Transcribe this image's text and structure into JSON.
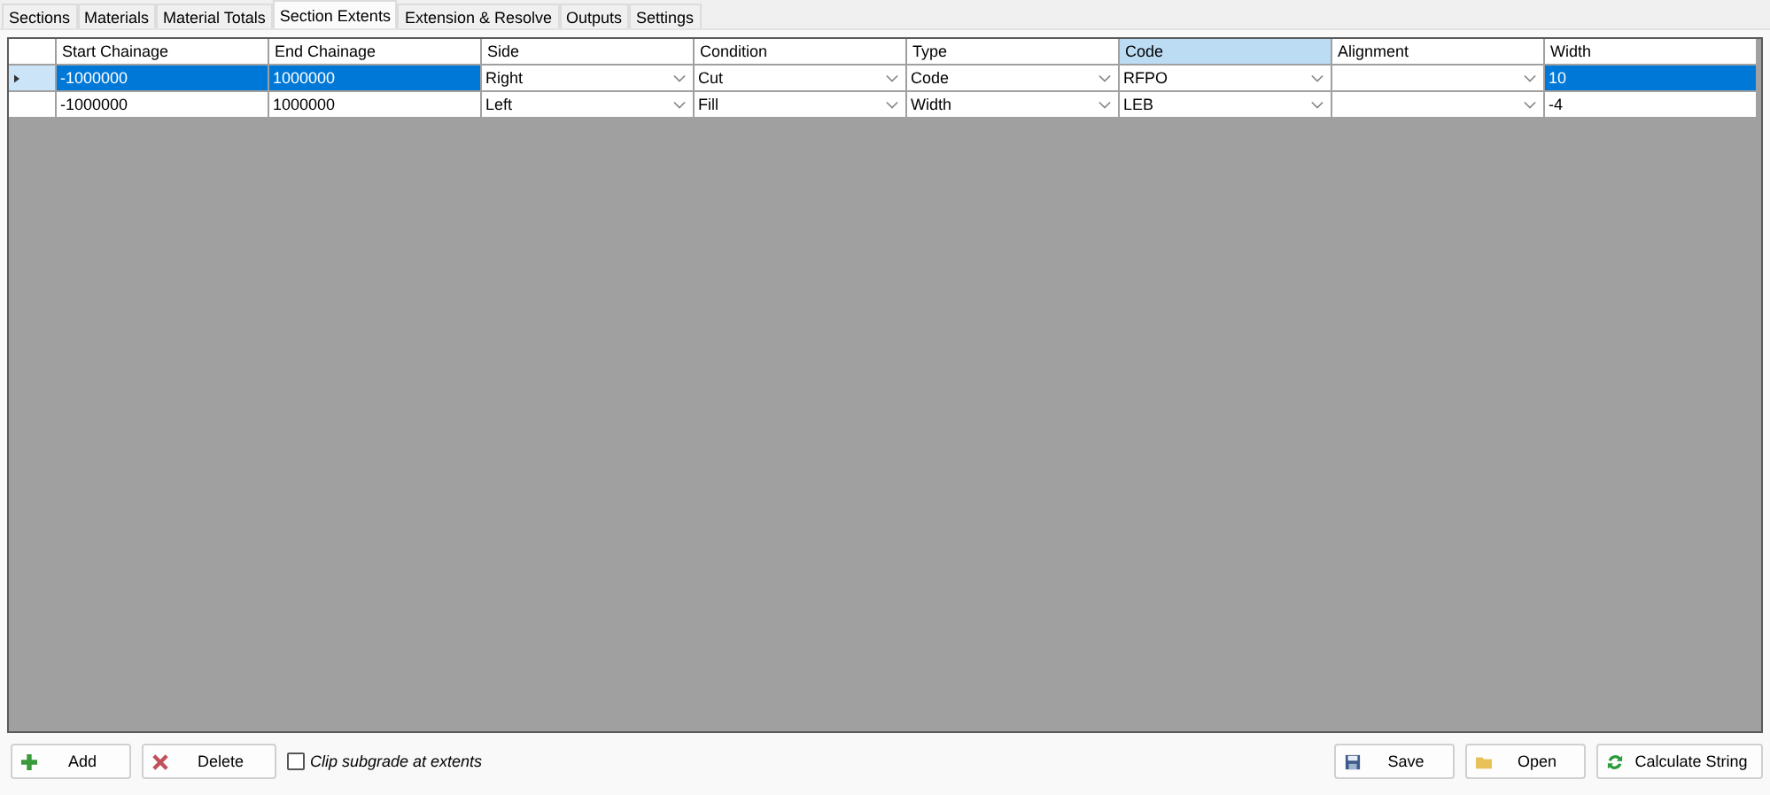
{
  "tabs": [
    {
      "label": "Sections",
      "selected": false
    },
    {
      "label": "Materials",
      "selected": false
    },
    {
      "label": "Material Totals",
      "selected": false
    },
    {
      "label": "Section Extents",
      "selected": true
    },
    {
      "label": "Extension & Resolve",
      "selected": false
    },
    {
      "label": "Outputs",
      "selected": false
    },
    {
      "label": "Settings",
      "selected": false
    }
  ],
  "grid": {
    "columns": [
      {
        "label": "Start Chainage",
        "kind": "text",
        "selected": false
      },
      {
        "label": "End Chainage",
        "kind": "text",
        "selected": false
      },
      {
        "label": "Side",
        "kind": "combo",
        "selected": false
      },
      {
        "label": "Condition",
        "kind": "combo",
        "selected": false
      },
      {
        "label": "Type",
        "kind": "combo",
        "selected": false
      },
      {
        "label": "Code",
        "kind": "combo",
        "selected": true
      },
      {
        "label": "Alignment",
        "kind": "combo",
        "selected": false
      },
      {
        "label": "Width",
        "kind": "text",
        "selected": false
      }
    ],
    "rows": [
      {
        "selected": true,
        "cells": [
          "-1000000",
          "1000000",
          "Right",
          "Cut",
          "Code",
          "RFPO",
          null,
          "10"
        ]
      },
      {
        "selected": false,
        "cells": [
          "-1000000",
          "1000000",
          "Left",
          "Fill",
          "Width",
          "LEB",
          null,
          "-4"
        ]
      }
    ]
  },
  "left_buttons": [
    {
      "label": "Add",
      "kind": "add"
    },
    {
      "label": "Delete",
      "kind": "delete"
    }
  ],
  "checkbox": {
    "label": "Clip subgrade at extents",
    "checked": false
  },
  "right_buttons": [
    {
      "label": "Save",
      "kind": "save"
    },
    {
      "label": "Open",
      "kind": "open"
    },
    {
      "label": "Calculate String",
      "kind": "calculate"
    }
  ]
}
